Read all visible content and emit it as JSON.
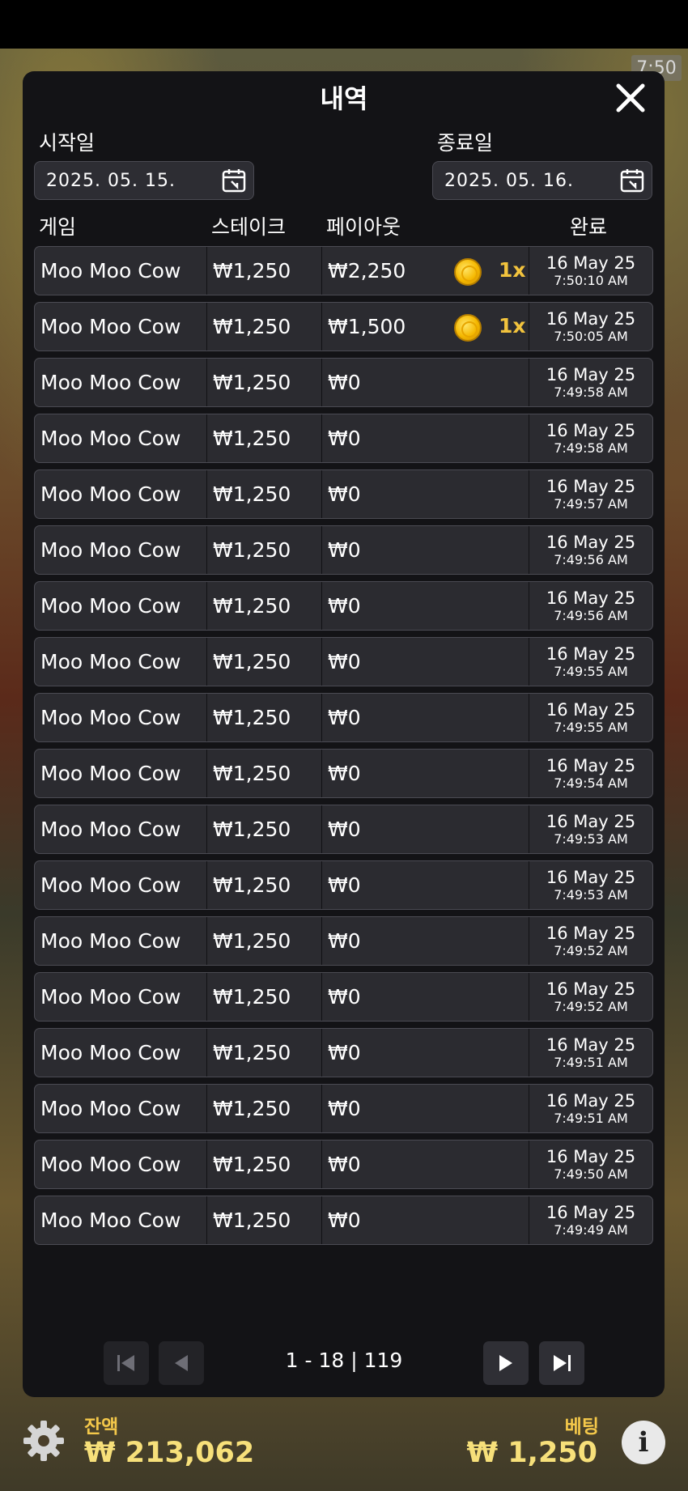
{
  "status": {
    "time": "7:50"
  },
  "modal": {
    "title": "내역",
    "start_label": "시작일",
    "start_date": "2025. 05. 15.",
    "end_label": "종료일",
    "end_date": "2025. 05. 16.",
    "columns": {
      "game": "게임",
      "stake": "스테이크",
      "payout": "페이아웃",
      "completed": "완료"
    },
    "rows": [
      {
        "game": "Moo Moo Cow",
        "stake": "₩1,250",
        "payout": "₩2,250",
        "mult": "1x",
        "date": "16 May 25",
        "time": "7:50:10 AM"
      },
      {
        "game": "Moo Moo Cow",
        "stake": "₩1,250",
        "payout": "₩1,500",
        "mult": "1x",
        "date": "16 May 25",
        "time": "7:50:05 AM"
      },
      {
        "game": "Moo Moo Cow",
        "stake": "₩1,250",
        "payout": "₩0",
        "mult": "",
        "date": "16 May 25",
        "time": "7:49:58 AM"
      },
      {
        "game": "Moo Moo Cow",
        "stake": "₩1,250",
        "payout": "₩0",
        "mult": "",
        "date": "16 May 25",
        "time": "7:49:58 AM"
      },
      {
        "game": "Moo Moo Cow",
        "stake": "₩1,250",
        "payout": "₩0",
        "mult": "",
        "date": "16 May 25",
        "time": "7:49:57 AM"
      },
      {
        "game": "Moo Moo Cow",
        "stake": "₩1,250",
        "payout": "₩0",
        "mult": "",
        "date": "16 May 25",
        "time": "7:49:56 AM"
      },
      {
        "game": "Moo Moo Cow",
        "stake": "₩1,250",
        "payout": "₩0",
        "mult": "",
        "date": "16 May 25",
        "time": "7:49:56 AM"
      },
      {
        "game": "Moo Moo Cow",
        "stake": "₩1,250",
        "payout": "₩0",
        "mult": "",
        "date": "16 May 25",
        "time": "7:49:55 AM"
      },
      {
        "game": "Moo Moo Cow",
        "stake": "₩1,250",
        "payout": "₩0",
        "mult": "",
        "date": "16 May 25",
        "time": "7:49:55 AM"
      },
      {
        "game": "Moo Moo Cow",
        "stake": "₩1,250",
        "payout": "₩0",
        "mult": "",
        "date": "16 May 25",
        "time": "7:49:54 AM"
      },
      {
        "game": "Moo Moo Cow",
        "stake": "₩1,250",
        "payout": "₩0",
        "mult": "",
        "date": "16 May 25",
        "time": "7:49:53 AM"
      },
      {
        "game": "Moo Moo Cow",
        "stake": "₩1,250",
        "payout": "₩0",
        "mult": "",
        "date": "16 May 25",
        "time": "7:49:53 AM"
      },
      {
        "game": "Moo Moo Cow",
        "stake": "₩1,250",
        "payout": "₩0",
        "mult": "",
        "date": "16 May 25",
        "time": "7:49:52 AM"
      },
      {
        "game": "Moo Moo Cow",
        "stake": "₩1,250",
        "payout": "₩0",
        "mult": "",
        "date": "16 May 25",
        "time": "7:49:52 AM"
      },
      {
        "game": "Moo Moo Cow",
        "stake": "₩1,250",
        "payout": "₩0",
        "mult": "",
        "date": "16 May 25",
        "time": "7:49:51 AM"
      },
      {
        "game": "Moo Moo Cow",
        "stake": "₩1,250",
        "payout": "₩0",
        "mult": "",
        "date": "16 May 25",
        "time": "7:49:51 AM"
      },
      {
        "game": "Moo Moo Cow",
        "stake": "₩1,250",
        "payout": "₩0",
        "mult": "",
        "date": "16 May 25",
        "time": "7:49:50 AM"
      },
      {
        "game": "Moo Moo Cow",
        "stake": "₩1,250",
        "payout": "₩0",
        "mult": "",
        "date": "16 May 25",
        "time": "7:49:49 AM"
      }
    ],
    "pagination": {
      "info": "1 - 18 | 119"
    }
  },
  "footer": {
    "balance_label": "잔액",
    "balance_value": "₩ 213,062",
    "bet_label": "베팅",
    "bet_value": "₩ 1,250"
  },
  "icons": {
    "close": "close-icon",
    "calendar": "calendar-icon",
    "coin": "coin-icon",
    "settings": "gear-icon",
    "info": "info-icon",
    "first": "first-page-icon",
    "prev": "prev-page-icon",
    "next": "next-page-icon",
    "last": "last-page-icon"
  },
  "colors": {
    "accent_gold": "#f2c33d",
    "modal_bg": "#131316",
    "row_bg": "#2b2b30"
  }
}
